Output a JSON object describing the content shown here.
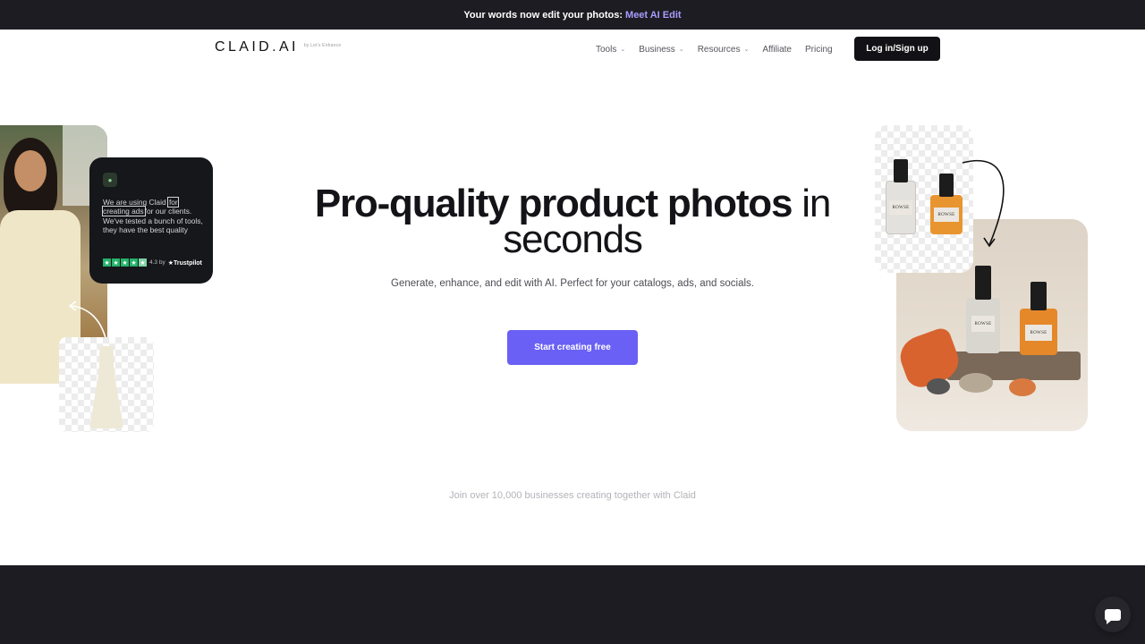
{
  "announcement": {
    "text": "Your words now edit your photos:",
    "link": "Meet AI Edit"
  },
  "header": {
    "logo": "CLAID.AI",
    "logo_sub": "by Let's Enhance",
    "nav": [
      {
        "label": "Tools",
        "dropdown": true
      },
      {
        "label": "Business",
        "dropdown": true
      },
      {
        "label": "Resources",
        "dropdown": true
      },
      {
        "label": "Affiliate",
        "dropdown": false
      },
      {
        "label": "Pricing",
        "dropdown": false
      }
    ],
    "login_label": "Log in/Sign up"
  },
  "hero": {
    "title_bold": "Pro-quality product photos",
    "title_light_1": "in",
    "title_light_2": "seconds",
    "subtitle": "Generate, enhance, and edit with AI. Perfect for your catalogs, ads, and socials.",
    "cta_label": "Start creating free",
    "join_text": "Join over 10,000 businesses creating together with Claid"
  },
  "review": {
    "quote_before": "We are using Claid",
    "quote_highlight": "for creating ads",
    "quote_after": "for our clients. We've tested a bunch of tools, they have the best quality",
    "rating": "4.3 by",
    "source": "Trustpilot"
  },
  "products": {
    "brand": "ROWSE"
  },
  "colors": {
    "accent": "#6a60f5",
    "dark": "#1c1c22",
    "link": "#a99cff",
    "trustpilot": "#24b36b"
  },
  "icons": [
    "user-icon",
    "star-icon",
    "chevron-down-icon",
    "chat-icon"
  ]
}
